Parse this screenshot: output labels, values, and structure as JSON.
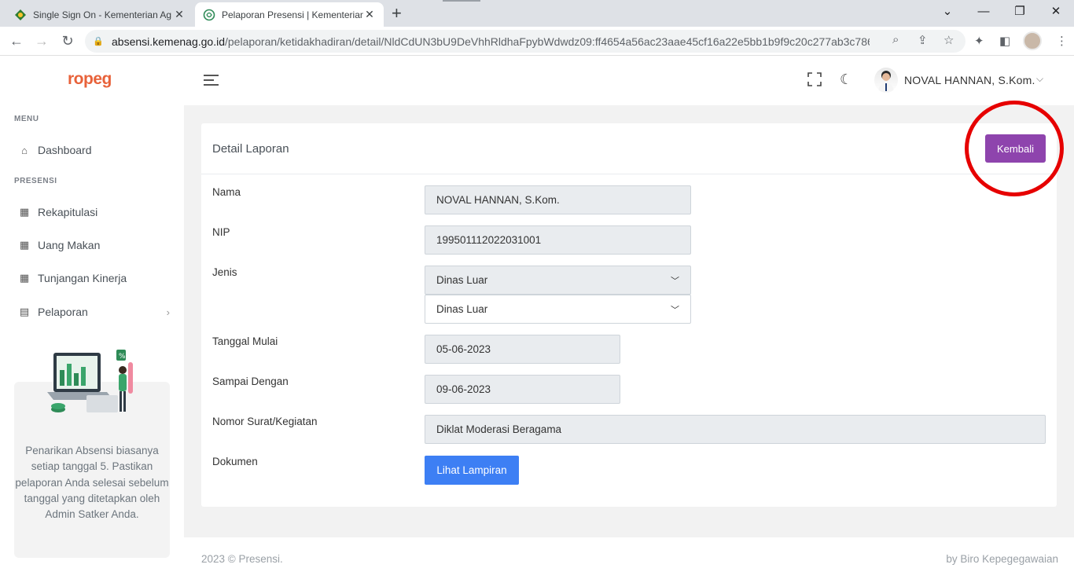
{
  "browser": {
    "tabs": [
      {
        "title": "Single Sign On - Kementerian Ag"
      },
      {
        "title": "Pelaporan Presensi | Kementerian"
      }
    ],
    "url_host": "absensi.kemenag.go.id",
    "url_path": "/pelaporan/ketidakhadiran/detail/NldCdUN3bU9DeVhhRldhaFpybWdwdz09:ff4654a56ac23aae45cf16a22e5bb1b9f9c20c277ab3c786b2..."
  },
  "sidebar": {
    "logo": "ropeg",
    "menu_title": "MENU",
    "presensi_title": "PRESENSI",
    "items": [
      {
        "label": "Dashboard"
      },
      {
        "label": "Rekapitulasi"
      },
      {
        "label": "Uang Makan"
      },
      {
        "label": "Tunjangan Kinerja"
      },
      {
        "label": "Pelaporan"
      }
    ],
    "promo_text": "Penarikan Absensi biasanya setiap tanggal 5. Pastikan pelaporan Anda selesai sebelum tanggal yang ditetapkan oleh Admin Satker Anda."
  },
  "header": {
    "username": "NOVAL HANNAN, S.Kom."
  },
  "card": {
    "title": "Detail Laporan",
    "back_button": "Kembali",
    "fields": {
      "nama_label": "Nama",
      "nama_value": "NOVAL HANNAN, S.Kom.",
      "nip_label": "NIP",
      "nip_value": "199501112022031001",
      "jenis_label": "Jenis",
      "jenis_value_1": "Dinas Luar",
      "jenis_value_2": "Dinas Luar",
      "tanggal_mulai_label": "Tanggal Mulai",
      "tanggal_mulai_value": "05-06-2023",
      "sampai_label": "Sampai Dengan",
      "sampai_value": "09-06-2023",
      "nomor_label": "Nomor Surat/Kegiatan",
      "nomor_value": "Diklat Moderasi Beragama",
      "dokumen_label": "Dokumen",
      "lampiran_button": "Lihat Lampiran"
    }
  },
  "footer": {
    "left": "2023 © Presensi.",
    "right": "by Biro Kepegegawaian"
  },
  "colors": {
    "accent_purple": "#8e44ad",
    "button_blue": "#3d7ff4",
    "annotation_red": "#e60000",
    "logo_orange": "#e8623a"
  }
}
